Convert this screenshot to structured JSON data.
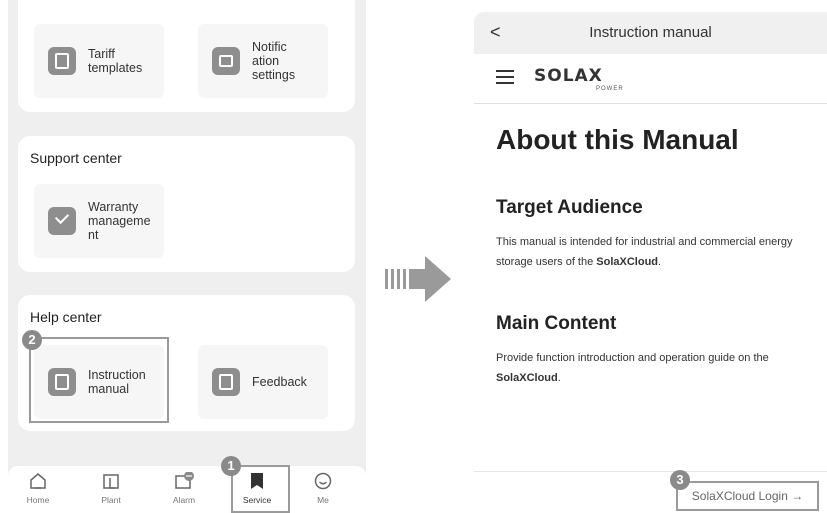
{
  "left": {
    "tiles_top": [
      {
        "label": "Tariff\ntemplates",
        "icon": "tariff-template-icon"
      },
      {
        "label": "Notific\nation\nsettings",
        "icon": "notification-settings-icon"
      }
    ],
    "support": {
      "title": "Support center",
      "tile": {
        "label": "Warranty\nmanageme\nnt",
        "icon": "warranty-shield-icon"
      }
    },
    "help": {
      "title": "Help center",
      "tiles": [
        {
          "label": "Instruction\nmanual",
          "icon": "document-icon"
        },
        {
          "label": "Feedback",
          "icon": "feedback-icon"
        }
      ]
    },
    "tabbar": [
      {
        "label": "Home",
        "icon": "home-icon"
      },
      {
        "label": "Plant",
        "icon": "plant-icon"
      },
      {
        "label": "Alarm",
        "icon": "alarm-icon"
      },
      {
        "label": "Service",
        "icon": "service-bookmark-icon"
      },
      {
        "label": "Me",
        "icon": "me-icon"
      }
    ],
    "badges": {
      "step1": "1",
      "step2": "2"
    }
  },
  "right": {
    "header_title": "Instruction manual",
    "back_label": "<",
    "logo_word": "SOLAX",
    "logo_sub": "POWER",
    "h1": "About this Manual",
    "section1_title": "Target Audience",
    "section1_text_a": "This manual is intended for industrial and commercial energy storage users of the ",
    "section1_text_b": "SolaXCloud",
    "section1_text_c": ".",
    "section2_title": "Main Content",
    "section2_text_a": "Provide function introduction and operation guide on the ",
    "section2_text_b": "SolaXCloud",
    "section2_text_c": ".",
    "login_label": "SolaXCloud Login →",
    "badge_step3": "3"
  },
  "colors": {
    "highlight": "#9a9a9a",
    "badge": "#8a8a8a",
    "icon_bg": "#8e8e8e",
    "panel_bg": "#efefef"
  }
}
